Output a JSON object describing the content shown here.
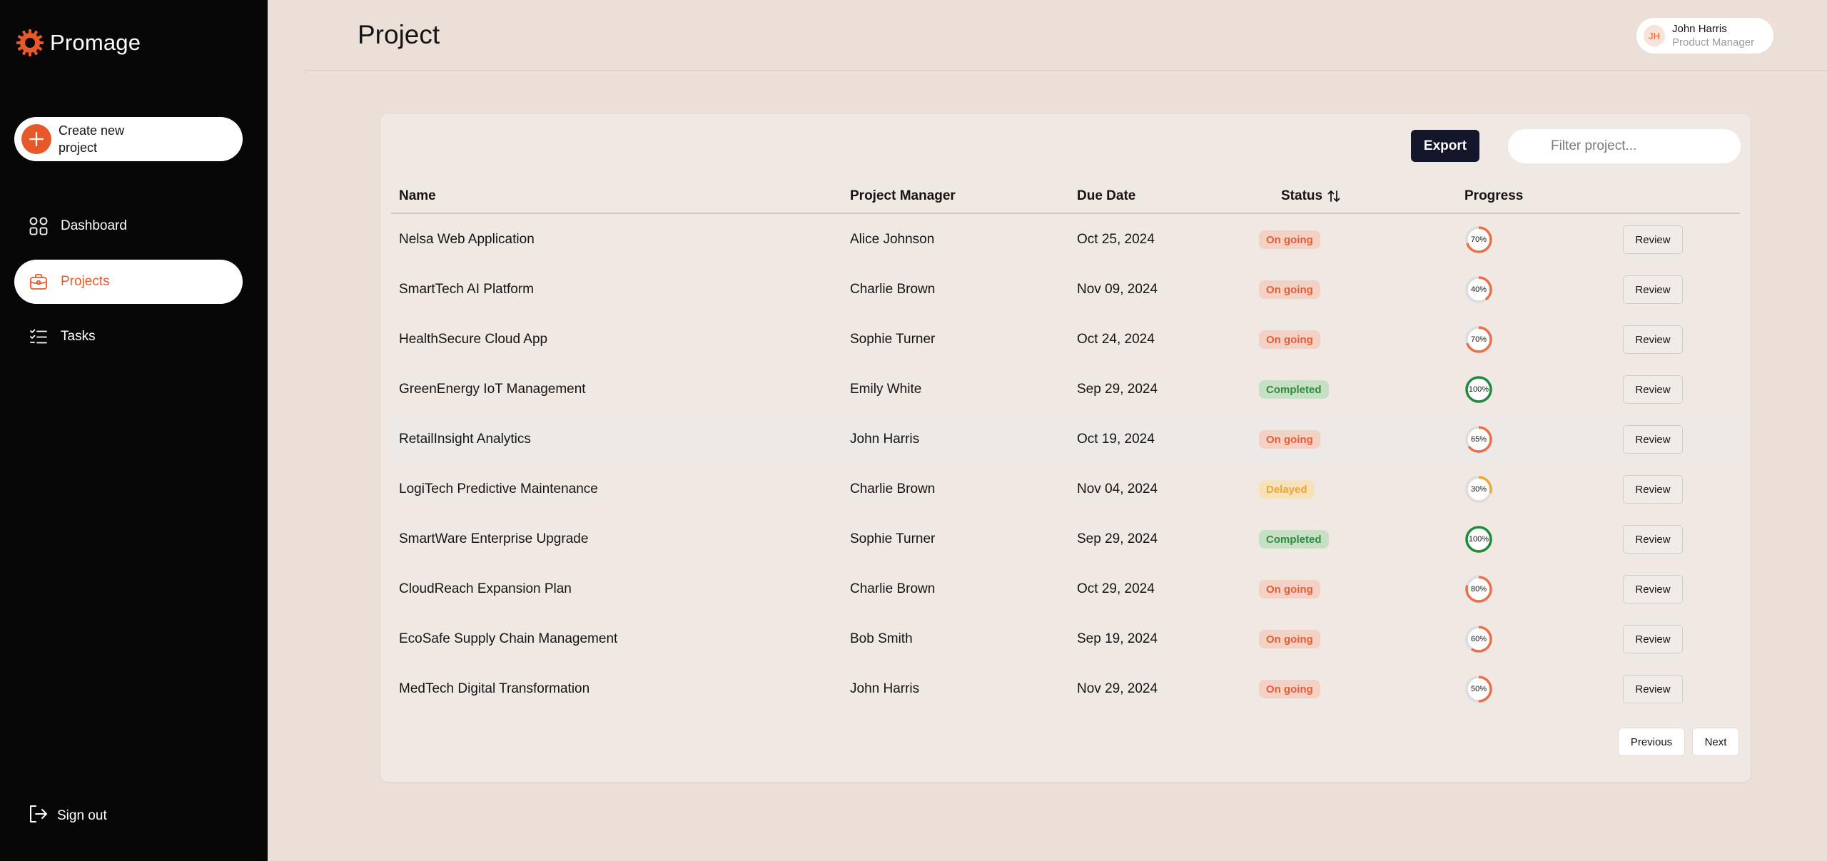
{
  "app": {
    "name": "Promage"
  },
  "sidebar": {
    "create_label": "Create new project",
    "items": [
      {
        "label": "Dashboard",
        "icon": "grid-icon",
        "active": false
      },
      {
        "label": "Projects",
        "icon": "briefcase-icon",
        "active": true
      },
      {
        "label": "Tasks",
        "icon": "checklist-icon",
        "active": false
      }
    ],
    "signout_label": "Sign out"
  },
  "header": {
    "title": "Project",
    "user": {
      "initials": "JH",
      "name": "John Harris",
      "role": "Product Manager"
    }
  },
  "toolbar": {
    "export_label": "Export",
    "filter_placeholder": "Filter project..."
  },
  "table": {
    "columns": {
      "name": "Name",
      "manager": "Project Manager",
      "due": "Due Date",
      "status": "Status",
      "progress": "Progress"
    },
    "review_label": "Review",
    "rows": [
      {
        "name": "Nelsa Web Application",
        "manager": "Alice Johnson",
        "due": "Oct 25, 2024",
        "status": "On going",
        "progress": 70,
        "progress_label": "70%"
      },
      {
        "name": "SmartTech AI Platform",
        "manager": "Charlie Brown",
        "due": "Nov 09, 2024",
        "status": "On going",
        "progress": 40,
        "progress_label": "40%"
      },
      {
        "name": "HealthSecure Cloud App",
        "manager": "Sophie Turner",
        "due": "Oct 24, 2024",
        "status": "On going",
        "progress": 70,
        "progress_label": "70%"
      },
      {
        "name": "GreenEnergy IoT Management",
        "manager": "Emily White",
        "due": "Sep 29, 2024",
        "status": "Completed",
        "progress": 100,
        "progress_label": "100%"
      },
      {
        "name": "RetailInsight Analytics",
        "manager": "John Harris",
        "due": "Oct 19, 2024",
        "status": "On going",
        "progress": 65,
        "progress_label": "65%"
      },
      {
        "name": "LogiTech Predictive Maintenance",
        "manager": "Charlie Brown",
        "due": "Nov 04, 2024",
        "status": "Delayed",
        "progress": 30,
        "progress_label": "30%"
      },
      {
        "name": "SmartWare Enterprise Upgrade",
        "manager": "Sophie Turner",
        "due": "Sep 29, 2024",
        "status": "Completed",
        "progress": 100,
        "progress_label": "100%"
      },
      {
        "name": "CloudReach Expansion Plan",
        "manager": "Charlie Brown",
        "due": "Oct 29, 2024",
        "status": "On going",
        "progress": 80,
        "progress_label": "80%"
      },
      {
        "name": "EcoSafe Supply Chain Management",
        "manager": "Bob Smith",
        "due": "Sep 19, 2024",
        "status": "On going",
        "progress": 60,
        "progress_label": "60%"
      },
      {
        "name": "MedTech Digital Transformation",
        "manager": "John Harris",
        "due": "Nov 29, 2024",
        "status": "On going",
        "progress": 50,
        "progress_label": "50%"
      }
    ]
  },
  "pagination": {
    "previous_label": "Previous",
    "next_label": "Next"
  },
  "colors": {
    "accent": "#e8592a",
    "sidebar_bg": "#070707",
    "page_bg": "#ebdfd7",
    "card_bg": "#f0e8e3",
    "ongoing_bg": "#f3d1c4",
    "ongoing_text": "#e0603a",
    "completed_bg": "#c7e0c4",
    "completed_text": "#2e8b40",
    "delayed_bg": "#f6e1b8",
    "delayed_text": "#e9a53c",
    "ring_track": "#dcdcdc",
    "ring_ongoing": "#e8704a",
    "ring_completed": "#1e8a3a",
    "ring_delayed": "#eaa83a"
  }
}
